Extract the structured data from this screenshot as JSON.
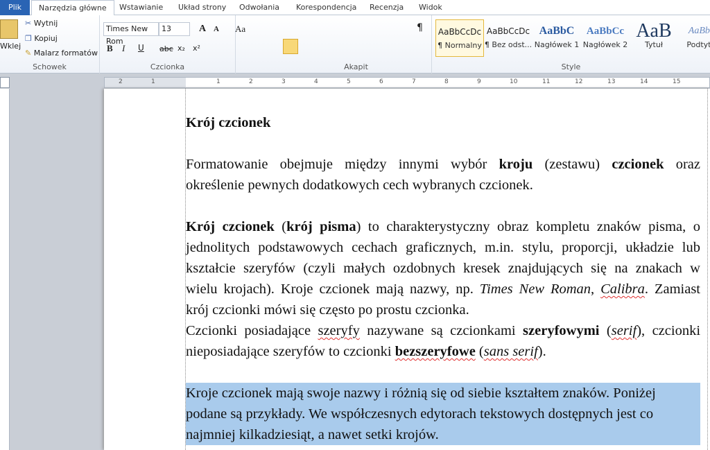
{
  "tabs": [
    "Plik",
    "Narzędzia główne",
    "Wstawianie",
    "Układ strony",
    "Odwołania",
    "Korespondencja",
    "Recenzja",
    "Widok"
  ],
  "clipboard": {
    "paste": "Wklej",
    "cut": "Wytnij",
    "copy": "Kopiuj",
    "painter": "Malarz formatów",
    "label": "Schowek"
  },
  "font": {
    "name": "Times New Rom",
    "size": "13",
    "label": "Czcionka",
    "bold": "B",
    "italic": "I",
    "underline": "U",
    "strike": "abc",
    "sub": "x₂",
    "sup": "x²",
    "case": "Aa",
    "grow": "A",
    "shrink": "A"
  },
  "paragraph": {
    "label": "Akapit",
    "pilcrow": "¶"
  },
  "styles": {
    "label": "Style",
    "items": [
      {
        "preview": "AaBbCcDc",
        "name": "¶ Normalny",
        "active": true
      },
      {
        "preview": "AaBbCcDc",
        "name": "¶ Bez odst...",
        "active": false
      },
      {
        "preview": "AaBbC",
        "name": "Nagłówek 1",
        "active": false
      },
      {
        "preview": "AaBbCc",
        "name": "Nagłówek 2",
        "active": false
      },
      {
        "preview": "AaB",
        "name": "Tytuł",
        "active": false
      },
      {
        "preview": "AaBbC",
        "name": "Podtytuł",
        "active": false
      }
    ]
  },
  "ruler": [
    "2",
    "1",
    "1",
    "2",
    "3",
    "4",
    "5",
    "6",
    "7",
    "8",
    "9",
    "10",
    "11",
    "12",
    "13",
    "14",
    "15"
  ],
  "colors": {
    "accent": "#2a64b4",
    "selection": "#a9cbec",
    "spell": "#e03030"
  },
  "document": {
    "blocks": [
      {
        "lines": [
          [
            {
              "t": "Krój czcionek",
              "b": 1
            }
          ]
        ]
      },
      {
        "lines": [
          [
            {
              "t": "Formatowanie obejmuje między innymi wybór "
            },
            {
              "t": "kroju",
              "b": 1
            },
            {
              "t": " (zestawu) "
            },
            {
              "t": "czcionek",
              "b": 1
            },
            {
              "t": " oraz"
            }
          ],
          [
            {
              "t": "określenie pewnych dodatkowych cech wybranych czcionek."
            }
          ]
        ]
      },
      {
        "lines": [
          [
            {
              "t": "Krój czcionek",
              "b": 1
            },
            {
              "t": " ("
            },
            {
              "t": "krój pisma",
              "b": 1
            },
            {
              "t": ") to charakterystyczny obraz kompletu znaków pisma, o"
            }
          ],
          [
            {
              "t": "jednolitych podstawowych cechach graficznych, m.in. stylu, proporcji, układzie lub"
            }
          ],
          [
            {
              "t": "kształcie szeryfów (czyli małych ozdobnych kresek znajdujących się na znakach w"
            }
          ],
          [
            {
              "t": "wielu krojach). Kroje czcionek mają nazwy, np. "
            },
            {
              "t": "Times New Roman",
              "i": 1
            },
            {
              "t": ", "
            },
            {
              "t": "Calibra",
              "i": 1,
              "sq": 1
            },
            {
              "t": ". Zamiast"
            }
          ],
          [
            {
              "t": "krój czcionki mówi się często po prostu czcionka."
            }
          ]
        ],
        "nogap": true
      },
      {
        "lines": [
          [
            {
              "t": "Czcionki posiadające "
            },
            {
              "t": "szeryfy",
              "sq": 1
            },
            {
              "t": " nazywane są czcionkami "
            },
            {
              "t": "szeryfowymi",
              "b": 1
            },
            {
              "t": " ("
            },
            {
              "t": "serif",
              "i": 1,
              "sq": 1
            },
            {
              "t": "), czcionki"
            }
          ],
          [
            {
              "t": "nieposiadające szeryfów to czcionki "
            },
            {
              "t": "bezszeryfowe",
              "b": 1,
              "sq": 1
            },
            {
              "t": " ("
            },
            {
              "t": "sans serif",
              "i": 1,
              "sq": 1
            },
            {
              "t": ")."
            }
          ]
        ]
      },
      {
        "selected": true,
        "lines": [
          [
            {
              "t": "Kroje czcionek mają swoje nazwy i różnią się od siebie kształtem znaków. Poniżej"
            }
          ],
          [
            {
              "t": "podane są przykłady. We współczesnych edytorach tekstowych dostępnych jest co"
            }
          ],
          [
            {
              "t": "najmniej kilkadziesiąt, a nawet setki krojów."
            }
          ]
        ]
      }
    ]
  }
}
